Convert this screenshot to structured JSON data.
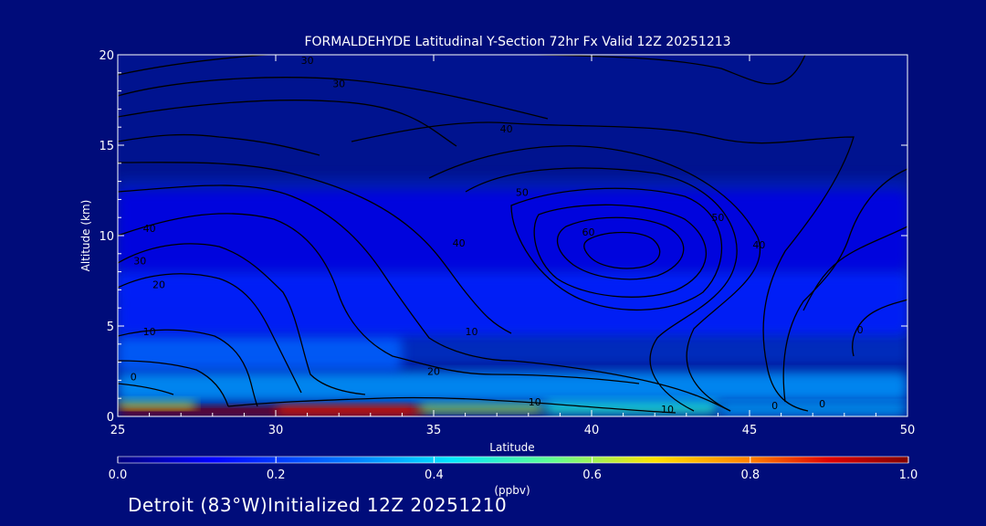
{
  "chart_data": {
    "type": "heatmap",
    "title": "FORMALDEHYDE Latitudinal Y-Section 72hr  Fx Valid 12Z 20251213",
    "xlabel": "Latitude",
    "ylabel": "Altitude (km)",
    "xlim": [
      25,
      50
    ],
    "ylim": [
      0,
      20
    ],
    "x_ticks": [
      "25",
      "30",
      "35",
      "40",
      "45",
      "50"
    ],
    "y_ticks": [
      "0",
      "5",
      "10",
      "15",
      "20"
    ],
    "colorbar": {
      "label": "(ppbv)",
      "range": [
        0.0,
        1.0
      ],
      "ticks": [
        "0.0",
        "0.2",
        "0.4",
        "0.6",
        "0.8",
        "1.0"
      ],
      "colors": [
        "#000080",
        "#0000ff",
        "#0080ff",
        "#00e5ff",
        "#60ff90",
        "#ffe000",
        "#ff8000",
        "#e00000",
        "#800000"
      ]
    },
    "concentration_regions": [
      {
        "x": [
          25,
          34.8
        ],
        "y": [
          0,
          0.6
        ],
        "value": 0.98
      },
      {
        "x": [
          25,
          27.5
        ],
        "y": [
          0.4,
          1.0
        ],
        "value": 0.6
      },
      {
        "x": [
          30,
          34.5
        ],
        "y": [
          0.1,
          0.7
        ],
        "value": 0.85
      },
      {
        "x": [
          34.5,
          38.5
        ],
        "y": [
          0.2,
          0.8
        ],
        "value": 0.55
      },
      {
        "x": [
          38.5,
          44
        ],
        "y": [
          0.1,
          1.0
        ],
        "value": 0.42
      },
      {
        "x": [
          44,
          50
        ],
        "y": [
          0,
          0.8
        ],
        "value": 0.3
      },
      {
        "x": [
          25,
          50
        ],
        "y": [
          0.8,
          2.5
        ],
        "value": 0.28
      },
      {
        "x": [
          25,
          34
        ],
        "y": [
          2.5,
          4.5
        ],
        "value": 0.22
      },
      {
        "x": [
          25,
          50
        ],
        "y": [
          4.5,
          8
        ],
        "value": 0.15
      },
      {
        "x": [
          25,
          50
        ],
        "y": [
          8,
          12.5
        ],
        "value": 0.1
      }
    ],
    "contour_labels": [
      {
        "x": 31.0,
        "y": 19.5,
        "text": "30"
      },
      {
        "x": 32.0,
        "y": 18.2,
        "text": "30"
      },
      {
        "x": 37.3,
        "y": 15.7,
        "text": "40"
      },
      {
        "x": 37.8,
        "y": 12.2,
        "text": "50"
      },
      {
        "x": 39.9,
        "y": 10.0,
        "text": "60"
      },
      {
        "x": 44.0,
        "y": 10.8,
        "text": "50"
      },
      {
        "x": 45.3,
        "y": 9.3,
        "text": "40"
      },
      {
        "x": 35.8,
        "y": 9.4,
        "text": "40"
      },
      {
        "x": 26.0,
        "y": 10.2,
        "text": "40"
      },
      {
        "x": 25.7,
        "y": 8.4,
        "text": "30"
      },
      {
        "x": 26.3,
        "y": 7.1,
        "text": "20"
      },
      {
        "x": 26.0,
        "y": 4.5,
        "text": "10"
      },
      {
        "x": 25.5,
        "y": 2.0,
        "text": "0"
      },
      {
        "x": 35.0,
        "y": 2.3,
        "text": "20"
      },
      {
        "x": 36.2,
        "y": 4.5,
        "text": "10"
      },
      {
        "x": 38.2,
        "y": 0.6,
        "text": "10"
      },
      {
        "x": 42.4,
        "y": 0.2,
        "text": "10"
      },
      {
        "x": 45.8,
        "y": 0.4,
        "text": "0"
      },
      {
        "x": 47.3,
        "y": 0.5,
        "text": "0"
      },
      {
        "x": 48.5,
        "y": 4.6,
        "text": "0"
      }
    ]
  },
  "footer": {
    "text": "Detroit (83°W)Initialized 12Z 20251210"
  }
}
